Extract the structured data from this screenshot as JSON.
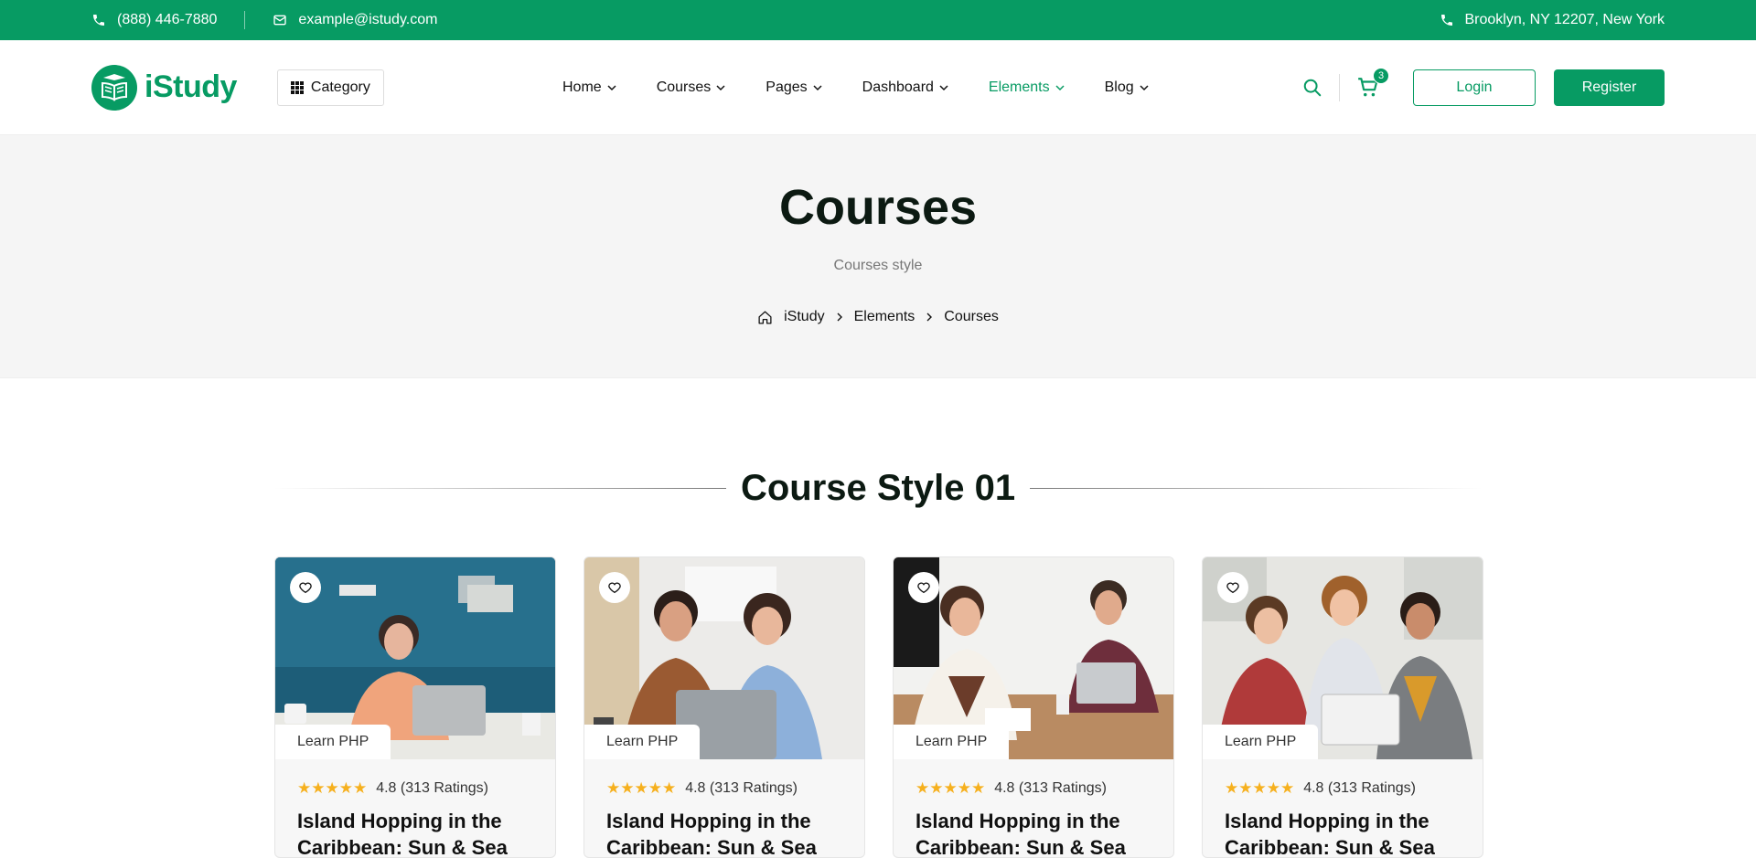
{
  "topbar": {
    "phone": "(888) 446-7880",
    "email": "example@istudy.com",
    "address": "Brooklyn, NY 12207, New York"
  },
  "header": {
    "logo_text": "iStudy",
    "category_label": "Category",
    "nav": [
      {
        "label": "Home"
      },
      {
        "label": "Courses"
      },
      {
        "label": "Pages"
      },
      {
        "label": "Dashboard"
      },
      {
        "label": "Elements"
      },
      {
        "label": "Blog"
      }
    ],
    "cart_count": "3",
    "login_label": "Login",
    "register_label": "Register"
  },
  "hero": {
    "title": "Courses",
    "subtitle": "Courses style",
    "breadcrumb": [
      "iStudy",
      "Elements",
      "Courses"
    ]
  },
  "section": {
    "title": "Course Style 01"
  },
  "cards": [
    {
      "tag": "Learn PHP",
      "stars": "★★★★★",
      "rating": "4.8 (313 Ratings)",
      "title": "Island Hopping in the Caribbean: Sun & Sea"
    },
    {
      "tag": "Learn PHP",
      "stars": "★★★★★",
      "rating": "4.8 (313 Ratings)",
      "title": "Island Hopping in the Caribbean: Sun & Sea"
    },
    {
      "tag": "Learn PHP",
      "stars": "★★★★★",
      "rating": "4.8 (313 Ratings)",
      "title": "Island Hopping in the Caribbean: Sun & Sea"
    },
    {
      "tag": "Learn PHP",
      "stars": "★★★★★",
      "rating": "4.8 (313 Ratings)",
      "title": "Island Hopping in the Caribbean: Sun & Sea"
    }
  ],
  "colors": {
    "brand": "#079b63",
    "hero_bg": "#f5f5f5",
    "star": "#f6b01e"
  }
}
